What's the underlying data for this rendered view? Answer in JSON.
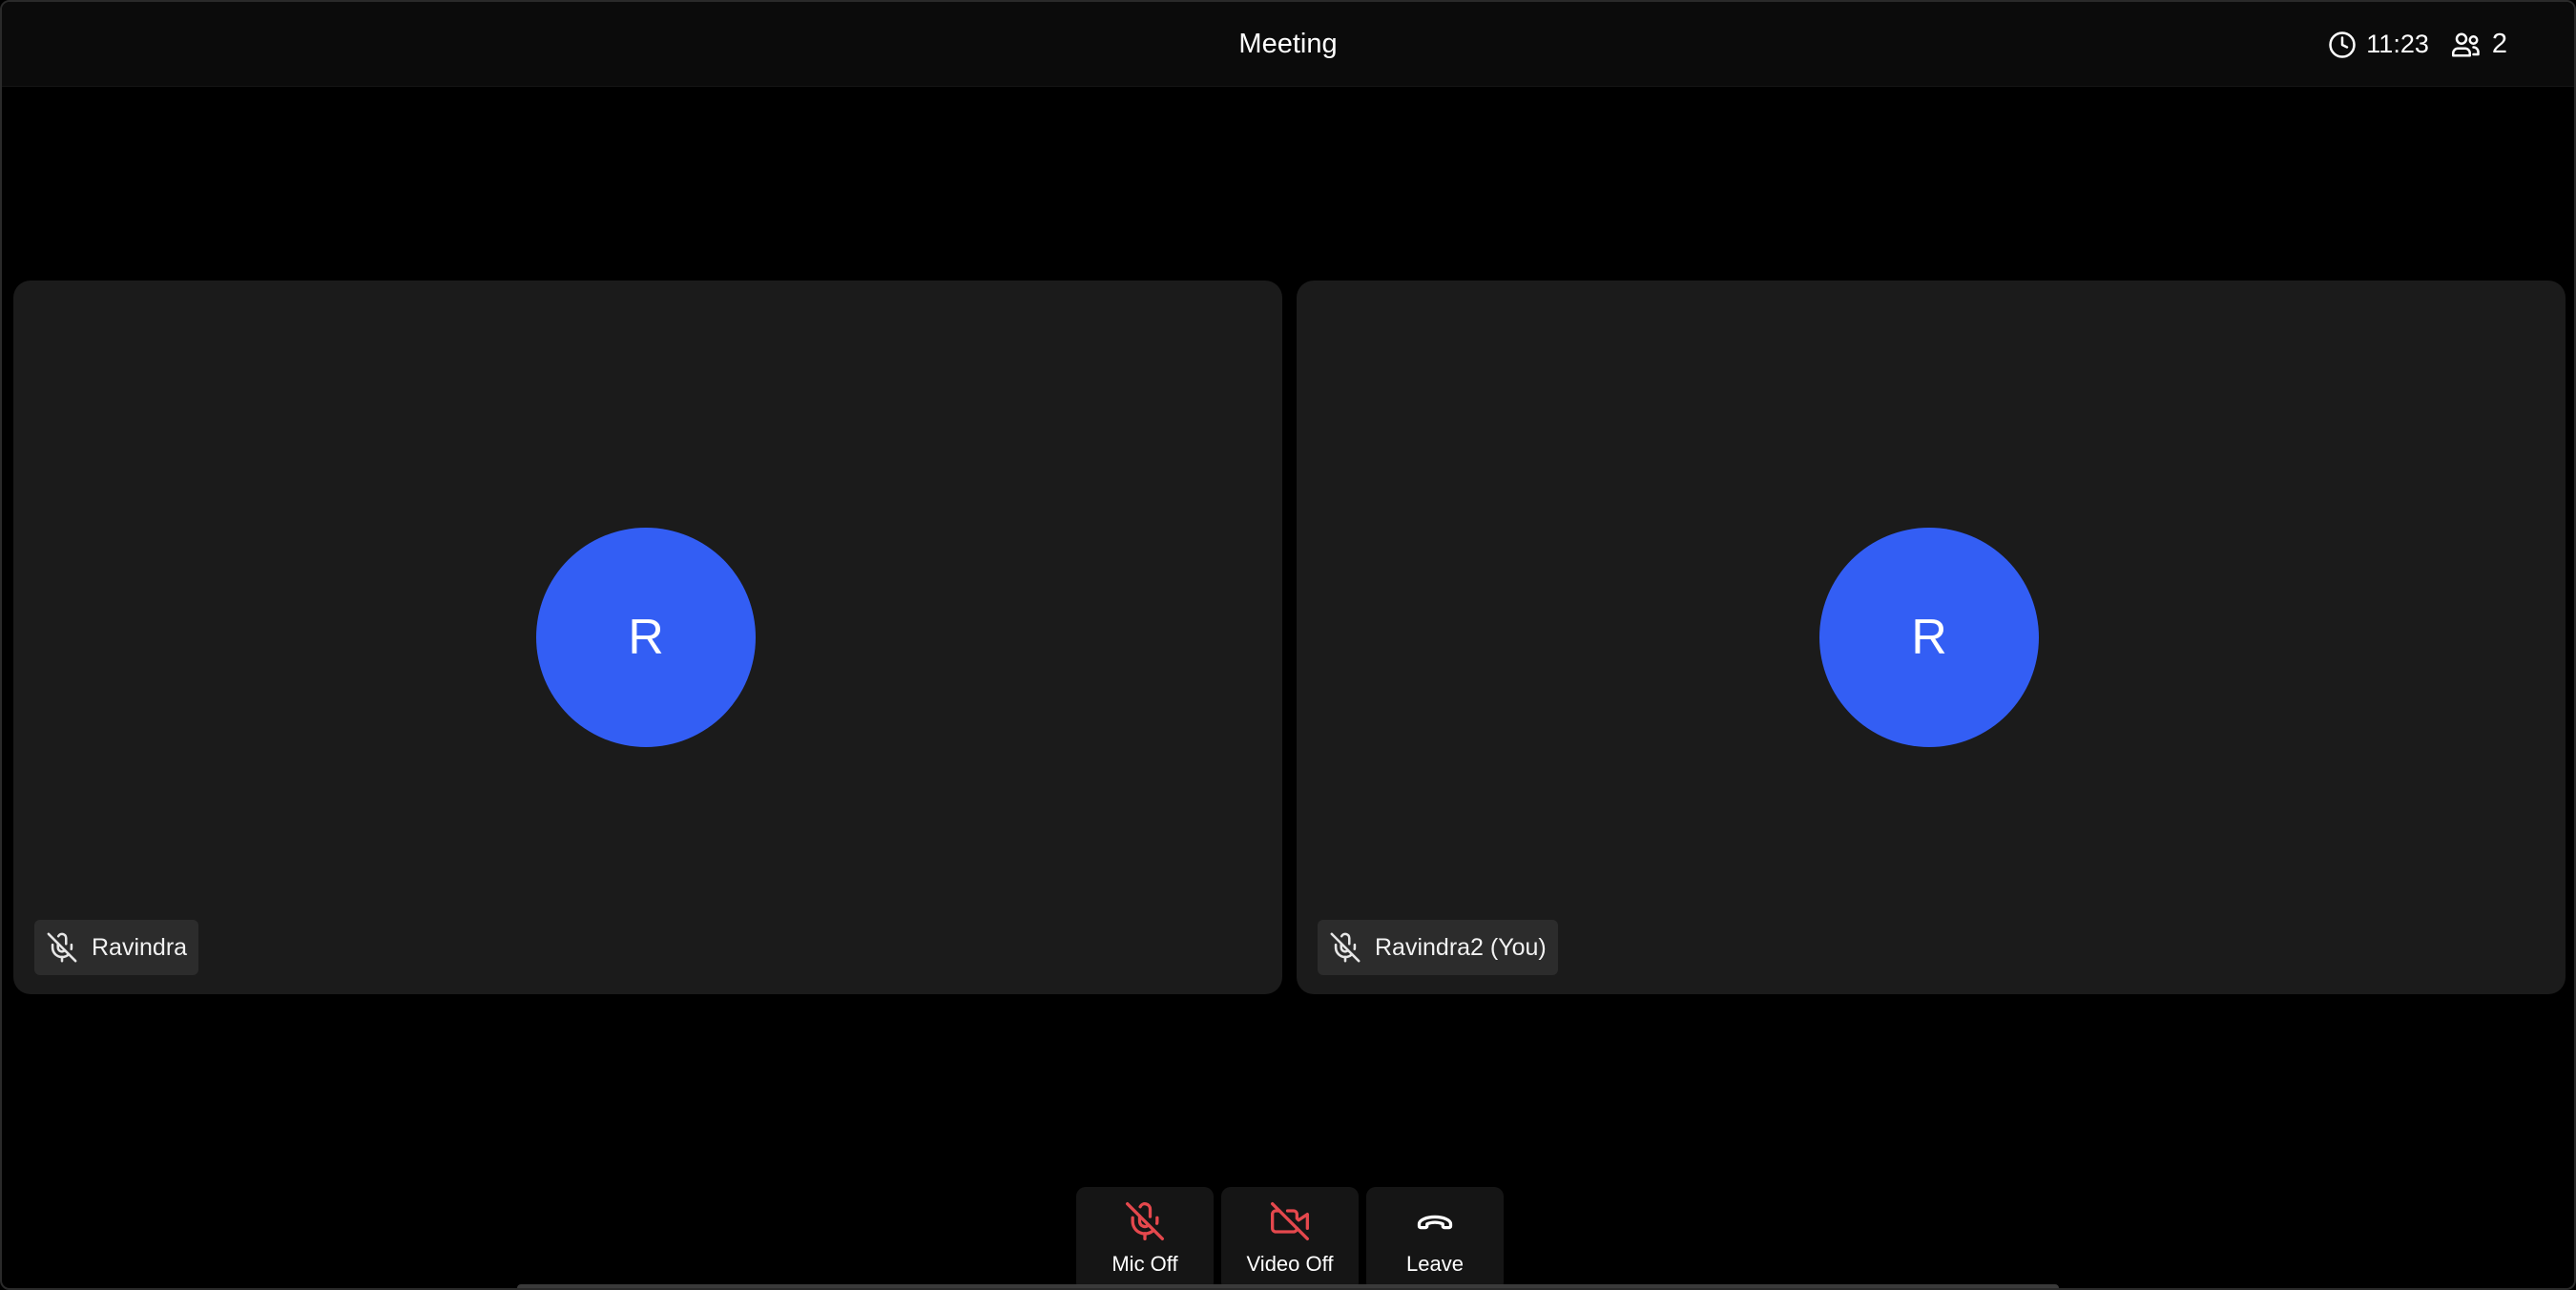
{
  "header": {
    "title": "Meeting",
    "timer": "11:23",
    "participant_count": "2"
  },
  "tiles": [
    {
      "initial": "R",
      "name": "Ravindra"
    },
    {
      "initial": "R",
      "name": "Ravindra2 (You)"
    }
  ],
  "controls": {
    "mic_label": "Mic Off",
    "video_label": "Video Off",
    "leave_label": "Leave"
  },
  "colors": {
    "background": "#000000",
    "tile": "#1b1b1b",
    "avatar": "#335ef4",
    "danger": "#e5484d"
  },
  "icons": [
    "clock-icon",
    "people-icon",
    "mic-off-icon",
    "video-off-icon",
    "phone-hangup-icon"
  ]
}
